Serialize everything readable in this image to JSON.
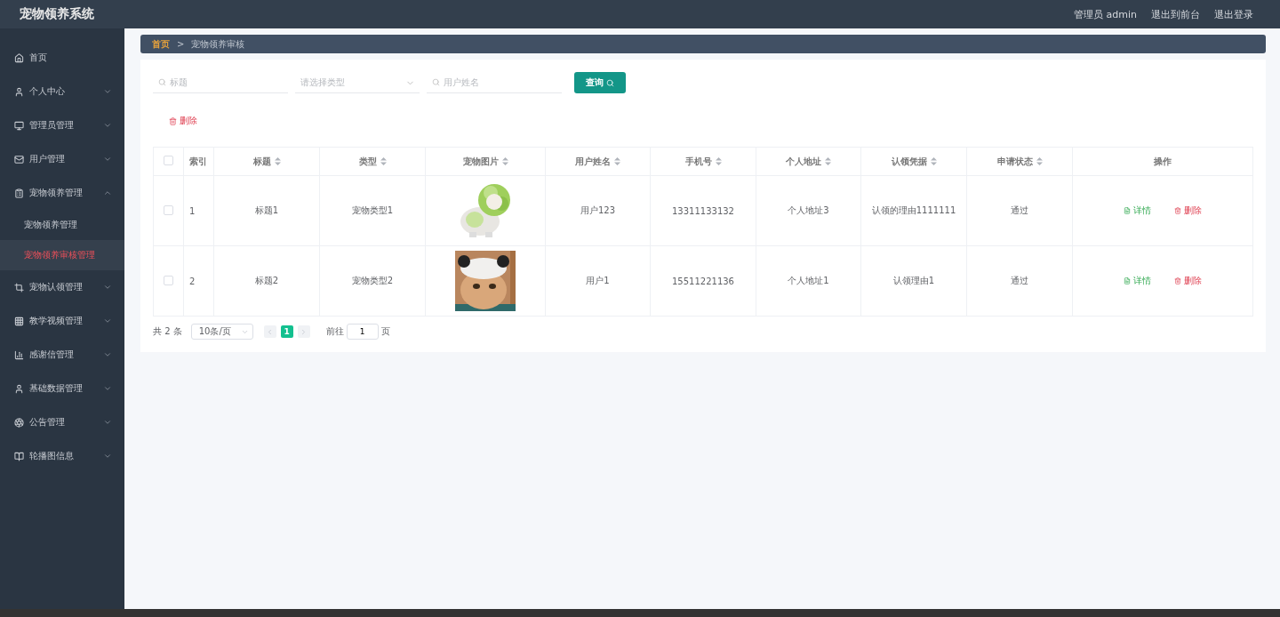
{
  "header": {
    "title": "宠物领养系统",
    "links": [
      "管理员 admin",
      "退出到前台",
      "退出登录"
    ]
  },
  "sidebar": {
    "items": [
      {
        "label": "首页"
      },
      {
        "label": "个人中心",
        "expanded": false
      },
      {
        "label": "管理员管理",
        "expanded": false
      },
      {
        "label": "用户管理",
        "expanded": false
      },
      {
        "label": "宠物领养管理",
        "expanded": true,
        "children": [
          {
            "label": "宠物领养管理",
            "selected": false
          },
          {
            "label": "宠物领养审核管理",
            "selected": true
          }
        ]
      },
      {
        "label": "宠物认领管理",
        "expanded": false
      },
      {
        "label": "教学视频管理",
        "expanded": false
      },
      {
        "label": "感谢信管理",
        "expanded": false
      },
      {
        "label": "基础数据管理",
        "expanded": false
      },
      {
        "label": "公告管理",
        "expanded": false
      },
      {
        "label": "轮播图信息",
        "expanded": false
      }
    ]
  },
  "breadcrumb": [
    "首页",
    ">",
    "宠物领养审核"
  ],
  "filters": {
    "title": {
      "placeholder": "标题"
    },
    "type": {
      "placeholder": "请选择类型"
    },
    "username": {
      "placeholder": "用户姓名"
    },
    "query_button": "查询"
  },
  "delete_button": "删除",
  "table": {
    "all_checked": false,
    "columns": [
      {
        "label": "索引",
        "sortable": false
      },
      {
        "label": "标题",
        "sortable": true
      },
      {
        "label": "类型",
        "sortable": true
      },
      {
        "label": "宠物图片",
        "sortable": true
      },
      {
        "label": "用户姓名",
        "sortable": true
      },
      {
        "label": "手机号",
        "sortable": true
      },
      {
        "label": "个人地址",
        "sortable": true
      },
      {
        "label": "认领凭据",
        "sortable": true
      },
      {
        "label": "申请状态",
        "sortable": true
      },
      {
        "label": "操作",
        "sortable": false
      }
    ],
    "rows": [
      {
        "checked": false,
        "index": "1",
        "title": "标题1",
        "type": "宠物类型1",
        "picture": {
          "kind": "picture"
        },
        "username": "用户123",
        "phone": "13311133132",
        "address": "个人地址3",
        "proof": "认领的理由1111111",
        "status": "通过",
        "actions": [
          "详情",
          "删除"
        ]
      },
      {
        "checked": false,
        "index": "2",
        "title": "标题2",
        "type": "宠物类型2",
        "picture": {
          "kind": "picture"
        },
        "username": "用户1",
        "phone": "15511221136",
        "address": "个人地址1",
        "proof": "认领理由1",
        "status": "通过",
        "actions": [
          "详情",
          "删除"
        ]
      }
    ]
  },
  "pagination": {
    "total": "共 2 条",
    "page_size": "10条/页",
    "pages": [
      {
        "label": "1",
        "selected": true
      }
    ],
    "goto_label": "前往",
    "goto_value": "1",
    "goto_suffix": "页"
  }
}
